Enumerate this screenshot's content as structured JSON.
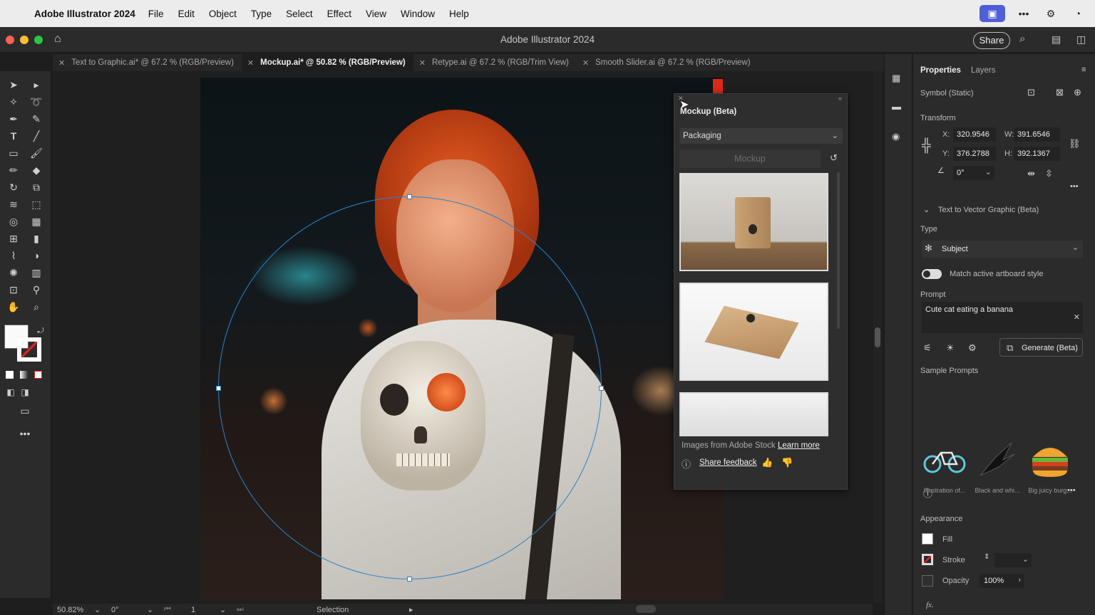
{
  "menubar": {
    "app_name": "Adobe Illustrator 2024",
    "items": [
      "File",
      "Edit",
      "Object",
      "Type",
      "Select",
      "Effect",
      "View",
      "Window",
      "Help"
    ]
  },
  "window": {
    "title": "Adobe Illustrator 2024",
    "share_label": "Share"
  },
  "tabs": [
    {
      "label": "Text to Graphic.ai* @ 67.2 % (RGB/Preview)",
      "active": false
    },
    {
      "label": "Mockup.ai* @ 50.82 % (RGB/Preview)",
      "active": true
    },
    {
      "label": "Retype.ai @ 67.2 % (RGB/Trim View)",
      "active": false
    },
    {
      "label": "Smooth Slider.ai @ 67.2 % (RGB/Preview)",
      "active": false
    }
  ],
  "mockup_panel": {
    "title": "Mockup (Beta)",
    "category": "Packaging",
    "mockup_button": "Mockup",
    "stock_text": "Images from Adobe Stock",
    "learn_more": "Learn more",
    "share_feedback": "Share feedback"
  },
  "properties": {
    "tab_properties": "Properties",
    "tab_layers": "Layers",
    "object_type": "Symbol (Static)",
    "transform_heading": "Transform",
    "x_label": "X:",
    "x_value": "320.9546",
    "y_label": "Y:",
    "y_value": "376.2788",
    "w_label": "W:",
    "w_value": "391.6546",
    "h_label": "H:",
    "h_value": "392.1367",
    "angle_value": "0°",
    "t2v_heading": "Text to Vector Graphic (Beta)",
    "type_label": "Type",
    "type_value": "Subject",
    "match_style_label": "Match active artboard style",
    "prompt_label": "Prompt",
    "prompt_value": "Cute cat eating a banana",
    "generate_label": "Generate (Beta)",
    "sample_prompts_label": "Sample Prompts",
    "samples": [
      "Illustration of...",
      "Black and whi...",
      "Big juicy burg..."
    ],
    "appearance_heading": "Appearance",
    "fill_label": "Fill",
    "stroke_label": "Stroke",
    "opacity_label": "Opacity",
    "opacity_value": "100%",
    "fx_label": "fx."
  },
  "statusbar": {
    "zoom": "50.82%",
    "rotation": "0°",
    "artboard_num": "1",
    "tool": "Selection"
  },
  "colors": {
    "accent": "#4f5fd8",
    "selection": "#2a83c9",
    "panel": "#2b2b2b"
  }
}
